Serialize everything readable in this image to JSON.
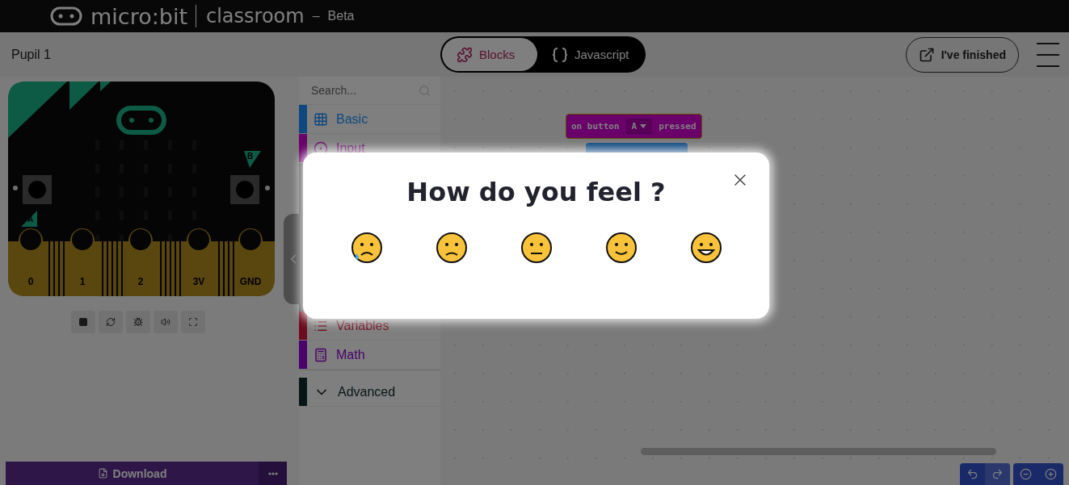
{
  "header": {
    "brand": "micro:bit",
    "product": "classroom",
    "dash": "–",
    "tag": "Beta"
  },
  "toolbar": {
    "pupil": "Pupil 1",
    "tabs": [
      {
        "label": "Blocks",
        "selected": true,
        "kind": "blocks"
      },
      {
        "label": "Javascript",
        "selected": false,
        "kind": "code"
      }
    ],
    "finish_button": "I've finished"
  },
  "simulator": {
    "button_a": "A",
    "button_b": "B",
    "pins": [
      "0",
      "1",
      "2",
      "3V",
      "GND"
    ]
  },
  "toolbox": {
    "search": {
      "placeholder": "Search..."
    },
    "categories": [
      {
        "kind": "basic",
        "label": "Basic",
        "color": "#0f487f"
      },
      {
        "kind": "input",
        "label": "Input",
        "color": "#6a006a"
      },
      {
        "kind": "covered"
      },
      {
        "kind": "variables",
        "label": "Variables",
        "color": "#6e0a1e"
      },
      {
        "kind": "math",
        "label": "Math",
        "color": "#4a006a"
      },
      {
        "kind": "advanced",
        "label": "Advanced",
        "color": "#061616"
      }
    ]
  },
  "workspace": {
    "block": {
      "before": "on button",
      "value": "A",
      "after": "pressed"
    }
  },
  "download": {
    "label": "Download"
  },
  "modal": {
    "title": "How do you feel ?"
  }
}
